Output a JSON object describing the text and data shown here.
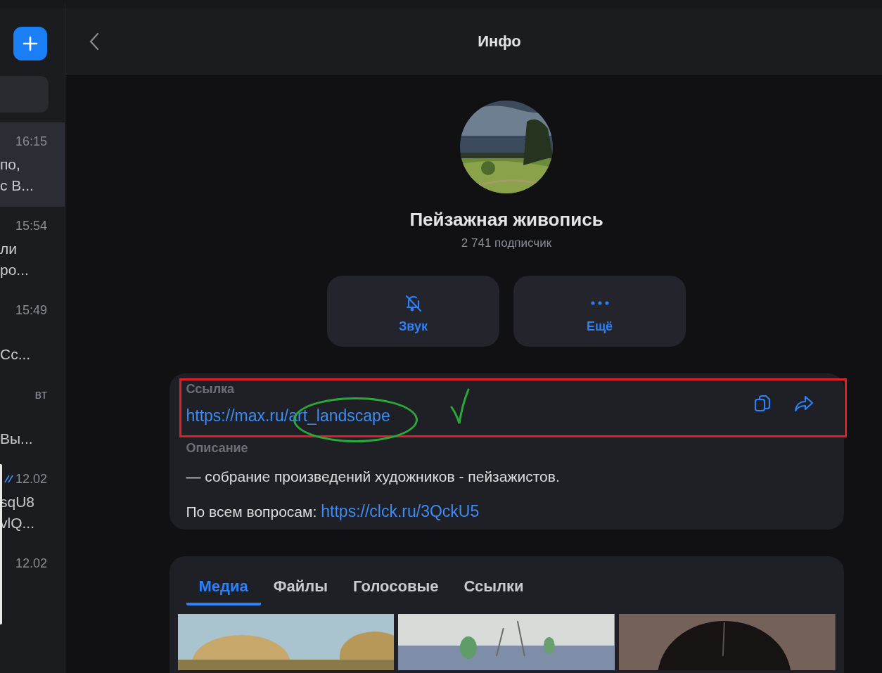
{
  "sidebar": {
    "chats": [
      {
        "time": "16:15",
        "lines": [
          "по,",
          "с В..."
        ],
        "selected": true,
        "read": false
      },
      {
        "time": "15:54",
        "lines": [
          "ли",
          "ро..."
        ],
        "selected": false,
        "read": false
      },
      {
        "time": "15:49",
        "lines": [
          "Сс..."
        ],
        "selected": false,
        "read": false
      },
      {
        "time": "вт",
        "lines": [
          "Вы..."
        ],
        "selected": false,
        "read": false
      },
      {
        "time": "12.02",
        "lines": [
          "sqU8",
          "vlQ..."
        ],
        "selected": false,
        "read": true
      },
      {
        "time": "12.02",
        "selected": false,
        "read": false
      }
    ]
  },
  "header": {
    "title": "Инфо"
  },
  "channel": {
    "name": "Пейзажная живопись",
    "subscribers": "2 741 подписчик"
  },
  "actions": [
    {
      "kind": "mute",
      "label": "Звук"
    },
    {
      "kind": "more",
      "label": "Ещё"
    }
  ],
  "info": {
    "link": {
      "label": "Ссылка",
      "url": "https://max.ru/art_landscape"
    },
    "description": {
      "label": "Описание",
      "text": "— собрание произведений художников - пейзажистов.",
      "contact_label": "По всем вопросам:",
      "contact_url": "https://clck.ru/3QckU5"
    }
  },
  "media_tabs": [
    {
      "label": "Медиа",
      "selected": true
    },
    {
      "label": "Файлы",
      "selected": false
    },
    {
      "label": "Голосовые",
      "selected": false
    },
    {
      "label": "Ссылки",
      "selected": false
    }
  ],
  "annotations": [
    {
      "kind": "frame"
    },
    {
      "kind": "ellipse"
    },
    {
      "kind": "check"
    }
  ]
}
